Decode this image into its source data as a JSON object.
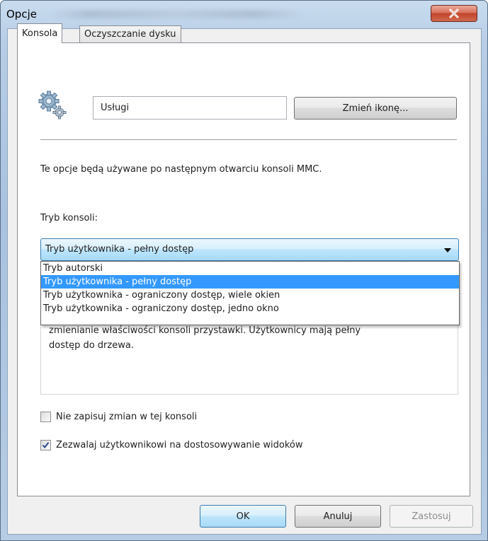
{
  "window": {
    "title": "Opcje"
  },
  "tabs": [
    {
      "label": "Konsola"
    },
    {
      "label": "Oczyszczanie dysku"
    }
  ],
  "console": {
    "name_value": "Usługi",
    "change_icon_button": "Zmień ikonę...",
    "info_text": "Te opcje będą używane po następnym otwarciu konsoli MMC.",
    "mode_label": "Tryb konsoli:",
    "mode_selected": "Tryb użytkownika - pełny dostęp",
    "mode_options": [
      "Tryb autorski",
      "Tryb użytkownika - pełny dostęp",
      "Tryb użytkownika - ograniczony dostęp, wiele okien",
      "Tryb użytkownika - ograniczony dostęp, jedno okno"
    ],
    "description_lines": [
      "zmienianie właściwości konsoli przystawki. Użytkownicy mają pełny",
      "dostęp do drzewa."
    ],
    "checkbox_no_save": {
      "label": "Nie zapisuj zmian w tej konsoli",
      "checked": false
    },
    "checkbox_allow_customize": {
      "label": "Zezwalaj użytkownikowi na dostosowywanie widoków",
      "checked": true
    }
  },
  "buttons": {
    "ok": "OK",
    "cancel": "Anuluj",
    "apply": "Zastosuj"
  },
  "colors": {
    "selection": "#3399ff",
    "close_button": "#c2432b"
  },
  "icons": {
    "console_icon": "gears-icon",
    "close": "close-icon"
  }
}
